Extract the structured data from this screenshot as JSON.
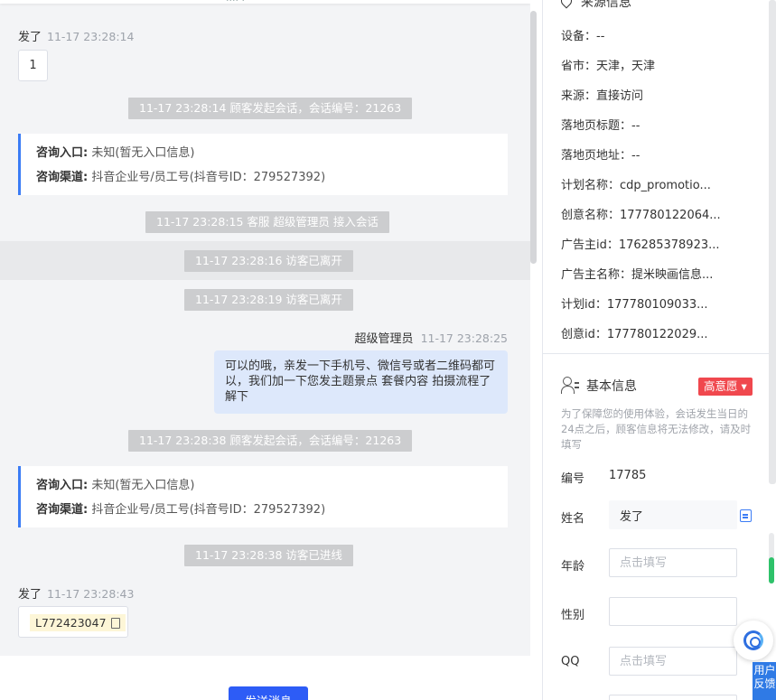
{
  "chat": {
    "top_cut_text": "···· ·",
    "msg1": {
      "sender": "发了",
      "time": "11-17 23:28:14",
      "text": "1"
    },
    "sys1": "11-17 23:28:14 顾客发起会话，会话编号：21263",
    "card1": {
      "entry_label": "咨询入口:",
      "entry_value": "未知(暂无入口信息)",
      "channel_label": "咨询渠道:",
      "channel_value": "抖音企业号/员工号(抖音号ID：279527392)"
    },
    "sys2": "11-17 23:28:15 客服 超级管理员 接入会话",
    "sys3": "11-17 23:28:16 访客已离开",
    "sys4": "11-17 23:28:19 访客已离开",
    "agent": {
      "name": "超级管理员",
      "time": "11-17 23:28:25",
      "text": "可以的哦，亲发一下手机号、微信号或者二维码都可以，我们加一下您发主题景点 套餐内容 拍摄流程了解下"
    },
    "sys5": "11-17 23:28:38 顾客发起会话，会话编号：21263",
    "card2": {
      "entry_label": "咨询入口:",
      "entry_value": "未知(暂无入口信息)",
      "channel_label": "咨询渠道:",
      "channel_value": "抖音企业号/员工号(抖音号ID：279527392)"
    },
    "sys6": "11-17 23:28:38 访客已进线",
    "msg2": {
      "sender": "发了",
      "time": "11-17 23:28:43",
      "code": "L772423047"
    },
    "send_label": "发送消息"
  },
  "panel": {
    "source_title": "来源信息",
    "source_rows": [
      "设备：--",
      "省市：天津，天津",
      "来源：直接访问",
      "落地页标题：--",
      "落地页地址：--",
      "计划名称：cdp_promotio...",
      "创意名称：177780122064...",
      "广告主id：176285378923...",
      "广告主名称：提米映画信息...",
      "计划id：177780109033...",
      "创意id：177780122029..."
    ],
    "basic_title": "基本信息",
    "intent_badge": "高意愿 ▾",
    "note": "为了保障您的使用体验，会话发生当日的24点之后，顾客信息将无法修改，请及时填写",
    "fields": {
      "id_label": "编号",
      "id_value": "17785",
      "name_label": "姓名",
      "name_value": "发了",
      "age_label": "年龄",
      "age_placeholder": "点击填写",
      "gender_label": "性别",
      "qq_label": "QQ",
      "qq_placeholder": "点击填写"
    },
    "feedback_label": "用户反馈"
  },
  "colors": {
    "accent": "#2d5cf6",
    "card_border": "#3b7cf5",
    "bubble": "#dde8fb",
    "badge": "#f0484e",
    "sys_bg": "#cccdcf"
  }
}
